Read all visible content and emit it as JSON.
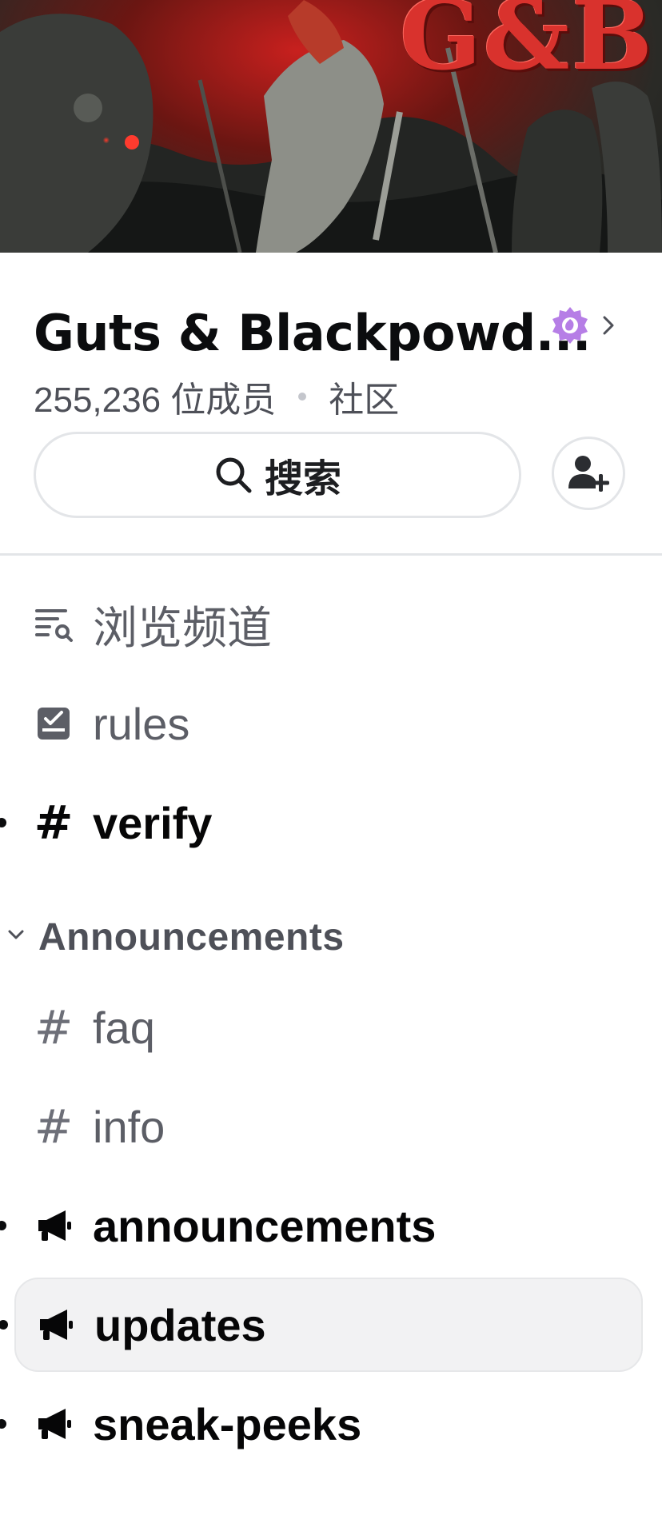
{
  "server": {
    "banner_logo": "G&B",
    "name": "Guts & Blackpowd...",
    "member_count": "255,236 位成员",
    "server_type": "社区"
  },
  "search": {
    "label": "搜索"
  },
  "nav": {
    "browse_channels": "浏览频道",
    "rules": "rules",
    "verify": "verify"
  },
  "category": {
    "name": "Announcements"
  },
  "channels": [
    {
      "name": "faq",
      "icon": "hash-icon",
      "unread": false
    },
    {
      "name": "info",
      "icon": "hash-icon",
      "unread": false
    },
    {
      "name": "announcements",
      "icon": "megaphone-icon",
      "unread": true
    },
    {
      "name": "updates",
      "icon": "megaphone-icon",
      "unread": true,
      "selected": true
    },
    {
      "name": "sneak-peeks",
      "icon": "megaphone-icon",
      "unread": true
    }
  ],
  "colors": {
    "boost_badge": "#b67ee6",
    "banner_red": "#c8201e",
    "selected_row": "#f2f2f3"
  }
}
